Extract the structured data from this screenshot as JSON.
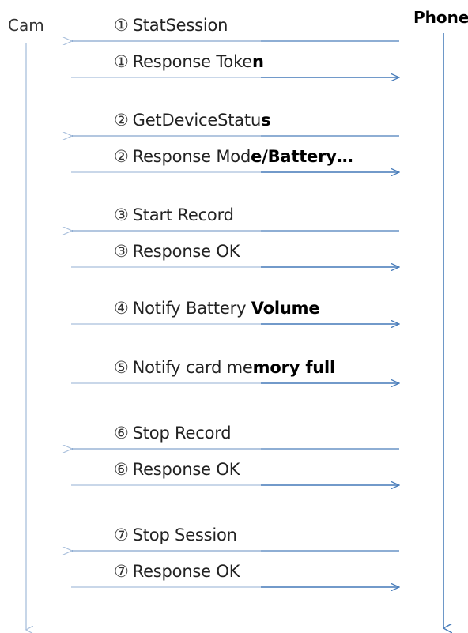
{
  "actors": {
    "left": "Cam",
    "right": "Phone"
  },
  "colors": {
    "arrow": "#4a7ebb",
    "lifeline_left": "#a9bfdc",
    "lifeline_right": "#4a7ebb"
  },
  "messages": [
    {
      "num": "①",
      "text": "StatSession",
      "bold_tail": "",
      "direction": "to-cam"
    },
    {
      "num": "①",
      "text": "Response Toke",
      "bold_tail": "n",
      "direction": "to-phone"
    },
    {
      "num": "②",
      "text": "GetDeviceStatu",
      "bold_tail": "s",
      "direction": "to-cam"
    },
    {
      "num": "②",
      "text": "Response Mod",
      "bold_tail": "e/Battery…",
      "direction": "to-phone"
    },
    {
      "num": "③",
      "text": "Start Record",
      "bold_tail": "",
      "direction": "to-cam"
    },
    {
      "num": "③",
      "text": "Response OK",
      "bold_tail": "",
      "direction": "to-phone"
    },
    {
      "num": "④",
      "text": "Notify Battery ",
      "bold_tail": "Volume",
      "direction": "to-phone"
    },
    {
      "num": "⑤",
      "text": "Notify card me",
      "bold_tail": "mory full",
      "direction": "to-phone"
    },
    {
      "num": "⑥",
      "text": "Stop Record",
      "bold_tail": "",
      "direction": "to-cam"
    },
    {
      "num": "⑥",
      "text": "Response OK",
      "bold_tail": "",
      "direction": "to-phone"
    },
    {
      "num": "⑦",
      "text": "Stop Session",
      "bold_tail": "",
      "direction": "to-cam"
    },
    {
      "num": "⑦",
      "text": "Response OK",
      "bold_tail": "",
      "direction": "to-phone"
    }
  ]
}
